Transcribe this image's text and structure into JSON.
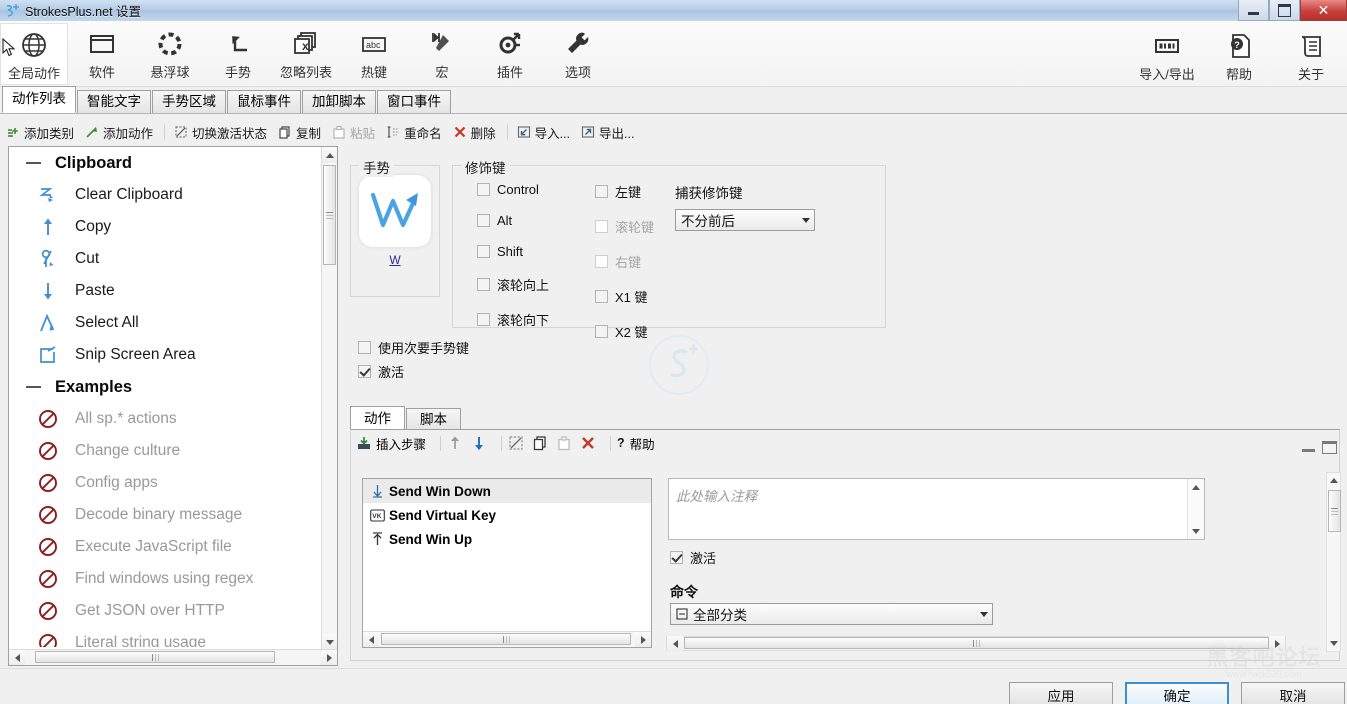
{
  "window": {
    "title": "StrokesPlus.net 设置",
    "icon": "app-icon",
    "controls": {
      "minimize": "最小化",
      "maximize": "最大化",
      "close": "✕"
    }
  },
  "ribbon": {
    "items": [
      {
        "label": "全局动作",
        "icon": "globe-icon",
        "selected": true
      },
      {
        "label": "软件",
        "icon": "window-icon",
        "selected": false
      },
      {
        "label": "悬浮球",
        "icon": "dashed-circle-icon",
        "selected": false
      },
      {
        "label": "手势",
        "icon": "arrow-turn-icon",
        "selected": false
      },
      {
        "label": "忽略列表",
        "icon": "windows-x-icon",
        "selected": false
      },
      {
        "label": "热键",
        "icon": "abc-icon",
        "selected": false
      },
      {
        "label": "宏",
        "icon": "macro-play-icon",
        "selected": false
      },
      {
        "label": "插件",
        "icon": "plugin-node-icon",
        "selected": false
      },
      {
        "label": "选项",
        "icon": "wrench-icon",
        "selected": false
      }
    ],
    "right_items": [
      {
        "label": "导入/导出",
        "icon": "import-export-icon"
      },
      {
        "label": "帮助",
        "icon": "help-doc-icon"
      },
      {
        "label": "关于",
        "icon": "about-scroll-icon"
      }
    ]
  },
  "tabs": {
    "items": [
      {
        "label": "动作列表",
        "active": true
      },
      {
        "label": "智能文字",
        "active": false
      },
      {
        "label": "手势区域",
        "active": false
      },
      {
        "label": "鼠标事件",
        "active": false
      },
      {
        "label": "加卸脚本",
        "active": false
      },
      {
        "label": "窗口事件",
        "active": false
      }
    ]
  },
  "command_bar": {
    "items": [
      {
        "label": "添加类别",
        "icon": "add-category-icon",
        "disabled": false
      },
      {
        "label": "添加动作",
        "icon": "add-action-icon",
        "disabled": false
      },
      {
        "label": "切换激活状态",
        "icon": "toggle-enable-icon",
        "disabled": false,
        "sep_before": true
      },
      {
        "label": "复制",
        "icon": "copy-icon",
        "disabled": false
      },
      {
        "label": "粘贴",
        "icon": "paste-icon",
        "disabled": true
      },
      {
        "label": "重命名",
        "icon": "rename-icon",
        "disabled": false
      },
      {
        "label": "删除",
        "icon": "delete-x-icon",
        "disabled": false
      },
      {
        "label": "导入...",
        "icon": "import-icon",
        "disabled": false,
        "sep_before": true
      },
      {
        "label": "导出...",
        "icon": "export-icon",
        "disabled": false
      }
    ]
  },
  "tree": {
    "groups": [
      {
        "label": "Clipboard",
        "expanded": true,
        "items": [
          {
            "label": "Clear Clipboard",
            "icon": "clear-clipboard-icon",
            "disabled": false
          },
          {
            "label": "Copy",
            "icon": "copy-up-arrow-icon",
            "disabled": false
          },
          {
            "label": "Cut",
            "icon": "cut-loop-icon",
            "disabled": false
          },
          {
            "label": "Paste",
            "icon": "paste-down-arrow-icon",
            "disabled": false
          },
          {
            "label": "Select All",
            "icon": "select-all-caret-icon",
            "disabled": false
          },
          {
            "label": "Snip Screen Area",
            "icon": "snip-rect-icon",
            "disabled": false
          }
        ]
      },
      {
        "label": "Examples",
        "expanded": true,
        "items": [
          {
            "label": "All sp.* actions",
            "icon": "disabled-circle-icon",
            "disabled": true
          },
          {
            "label": "Change culture",
            "icon": "disabled-circle-icon",
            "disabled": true
          },
          {
            "label": "Config apps",
            "icon": "disabled-circle-icon",
            "disabled": true
          },
          {
            "label": "Decode binary message",
            "icon": "disabled-circle-icon",
            "disabled": true
          },
          {
            "label": "Execute JavaScript file",
            "icon": "disabled-circle-icon",
            "disabled": true
          },
          {
            "label": "Find windows using regex",
            "icon": "disabled-circle-icon",
            "disabled": true
          },
          {
            "label": "Get JSON over HTTP",
            "icon": "disabled-circle-icon",
            "disabled": true
          },
          {
            "label": "Literal string usage",
            "icon": "disabled-circle-icon",
            "disabled": true
          }
        ]
      }
    ]
  },
  "gesture_box": {
    "title": "手势",
    "preview_icon": "gesture-w-stroke",
    "link_label": "W"
  },
  "modifiers": {
    "title": "修饰键",
    "column1": [
      {
        "label": "Control",
        "checked": false,
        "disabled": false
      },
      {
        "label": "Alt",
        "checked": false,
        "disabled": false
      },
      {
        "label": "Shift",
        "checked": false,
        "disabled": false
      },
      {
        "label": "滚轮向上",
        "checked": false,
        "disabled": false
      },
      {
        "label": "滚轮向下",
        "checked": false,
        "disabled": false
      }
    ],
    "column2": [
      {
        "label": "左键",
        "checked": false,
        "disabled": false
      },
      {
        "label": "滚轮键",
        "checked": false,
        "disabled": true
      },
      {
        "label": "右键",
        "checked": false,
        "disabled": true
      },
      {
        "label": "X1 键",
        "checked": false,
        "disabled": false
      },
      {
        "label": "X2 键",
        "checked": false,
        "disabled": false
      }
    ],
    "capture_label": "捕获修饰键",
    "capture_value": "不分前后"
  },
  "options": [
    {
      "label": "使用次要手势键",
      "checked": false
    },
    {
      "label": "激活",
      "checked": true
    }
  ],
  "inner_tabs": [
    {
      "label": "动作",
      "active": true
    },
    {
      "label": "脚本",
      "active": false
    }
  ],
  "action_toolbar": {
    "items": [
      {
        "label": "插入步骤",
        "icon": "insert-step-icon",
        "disabled": false
      },
      {
        "label": "",
        "icon": "move-up-icon",
        "disabled": true,
        "sep_before": true
      },
      {
        "label": "",
        "icon": "move-down-icon",
        "disabled": false
      },
      {
        "label": "",
        "icon": "toggle-step-icon",
        "disabled": false,
        "sep_before": true
      },
      {
        "label": "",
        "icon": "copy-step-icon",
        "disabled": false
      },
      {
        "label": "",
        "icon": "paste-step-icon",
        "disabled": true
      },
      {
        "label": "",
        "icon": "delete-step-icon",
        "disabled": false
      },
      {
        "label": "帮助",
        "icon": "question-icon",
        "disabled": false,
        "sep_before": true
      }
    ]
  },
  "steps": [
    {
      "label": "Send Win Down",
      "icon": "down-arrow-icon",
      "selected": true
    },
    {
      "label": "Send Virtual Key",
      "icon": "vk-badge-icon",
      "selected": false
    },
    {
      "label": "Send Win Up",
      "icon": "up-arrow-icon",
      "selected": false
    }
  ],
  "detail": {
    "note_placeholder": "此处输入注释",
    "note_value": "",
    "enabled_label": "激活",
    "enabled_checked": true,
    "command_label": "命令",
    "command_value": "全部分类",
    "command_icon": "category-icon"
  },
  "footer": {
    "apply_label": "应用",
    "ok_label": "确定",
    "cancel_label": "取消"
  },
  "watermark": {
    "line1": "黑客吧论坛",
    "line2": "www.hack520.com"
  },
  "colors": {
    "accent": "#3a8fd0",
    "tree_icon": "#3f8fd4",
    "disabled_icon": "#8c1f1f",
    "link": "#2b2b8f",
    "titlebar_close": "#c9413c"
  }
}
